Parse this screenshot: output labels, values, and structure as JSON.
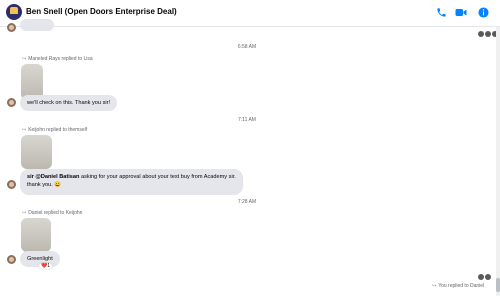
{
  "header": {
    "title": "Ben Snell (Open Doors Enterprise Deal)",
    "icons": [
      "phone-icon",
      "video-icon",
      "info-icon"
    ],
    "accent": "#0084ff"
  },
  "messages": {
    "t1": "6:58 AM",
    "reply1_label": "Maneled Rays replied to Lisa",
    "msg1": "we'll check on this. Thank you sir!",
    "t2": "7:11 AM",
    "reply2_label": "Keijohn replied to themself",
    "msg2_mention": "sir @Daniel Batisan",
    "msg2_rest": " asking for your approval about your test buy from Academy sir.",
    "msg2_line2": "thank you. 😀",
    "t3": "7:28 AM",
    "reply3_label": "Daniel replied to Keijohn",
    "msg3": "Greenlight",
    "reaction": "❤️",
    "reaction_count": "1",
    "you_replied": "You replied to Daniel"
  }
}
